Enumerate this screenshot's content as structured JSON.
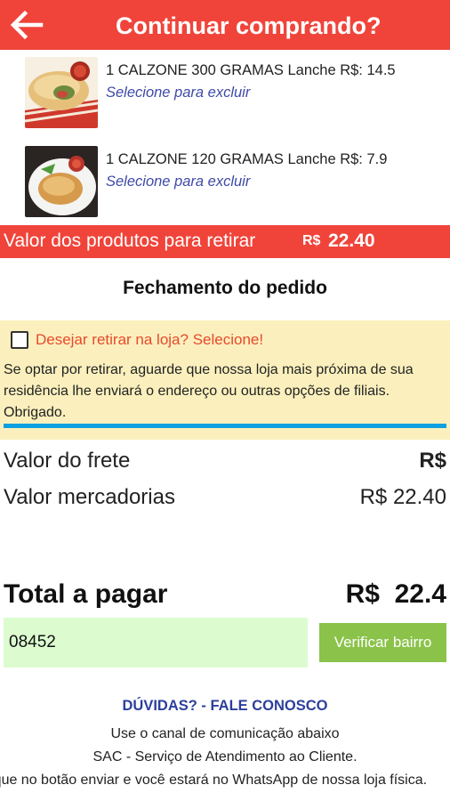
{
  "header": {
    "title": "Continuar comprando?",
    "back_icon": "arrow-left-icon",
    "background": "#f0443a"
  },
  "cart": {
    "items": [
      {
        "description": "1 CALZONE 300 GRAMAS Lanche R$: 14.5",
        "remove_label": "Selecione para excluir",
        "image": "calzone-300g-photo"
      },
      {
        "description": "1 CALZONE 120 GRAMAS Lanche R$: 7.9",
        "remove_label": "Selecione para excluir",
        "image": "calzone-120g-photo"
      }
    ]
  },
  "products_total": {
    "label": "Valor dos produtos para retirar",
    "currency": "R$",
    "value": "22.40"
  },
  "checkout": {
    "title": "Fechamento do pedido",
    "pickup": {
      "checkbox_label": "Desejar retirar na loja? Selecione!",
      "checked": false,
      "info": "Se optar por retirar, aguarde que nossa loja mais próxima de sua residência lhe enviará o endereço ou outras opções de filiais. Obrigado."
    },
    "shipping_label": "Valor do frete",
    "shipping_value": "R$",
    "goods_label": "Valor mercadorias",
    "goods_value": "R$ 22.40",
    "total_label": "Total a pagar",
    "total_value": "R$  22.4"
  },
  "cep": {
    "value": "08452",
    "button_label": "Verificar bairro"
  },
  "footer": {
    "doubts": "DÚVIDAS?",
    "separator": " - ",
    "contact": "FALE CONOSCO",
    "line1": "Use o canal de comunicação abaixo",
    "line2": "SAC - Serviço de Atendimento ao Cliente.",
    "line3": "Clique no botão enviar e você estará no WhatsApp de nossa loja física."
  }
}
